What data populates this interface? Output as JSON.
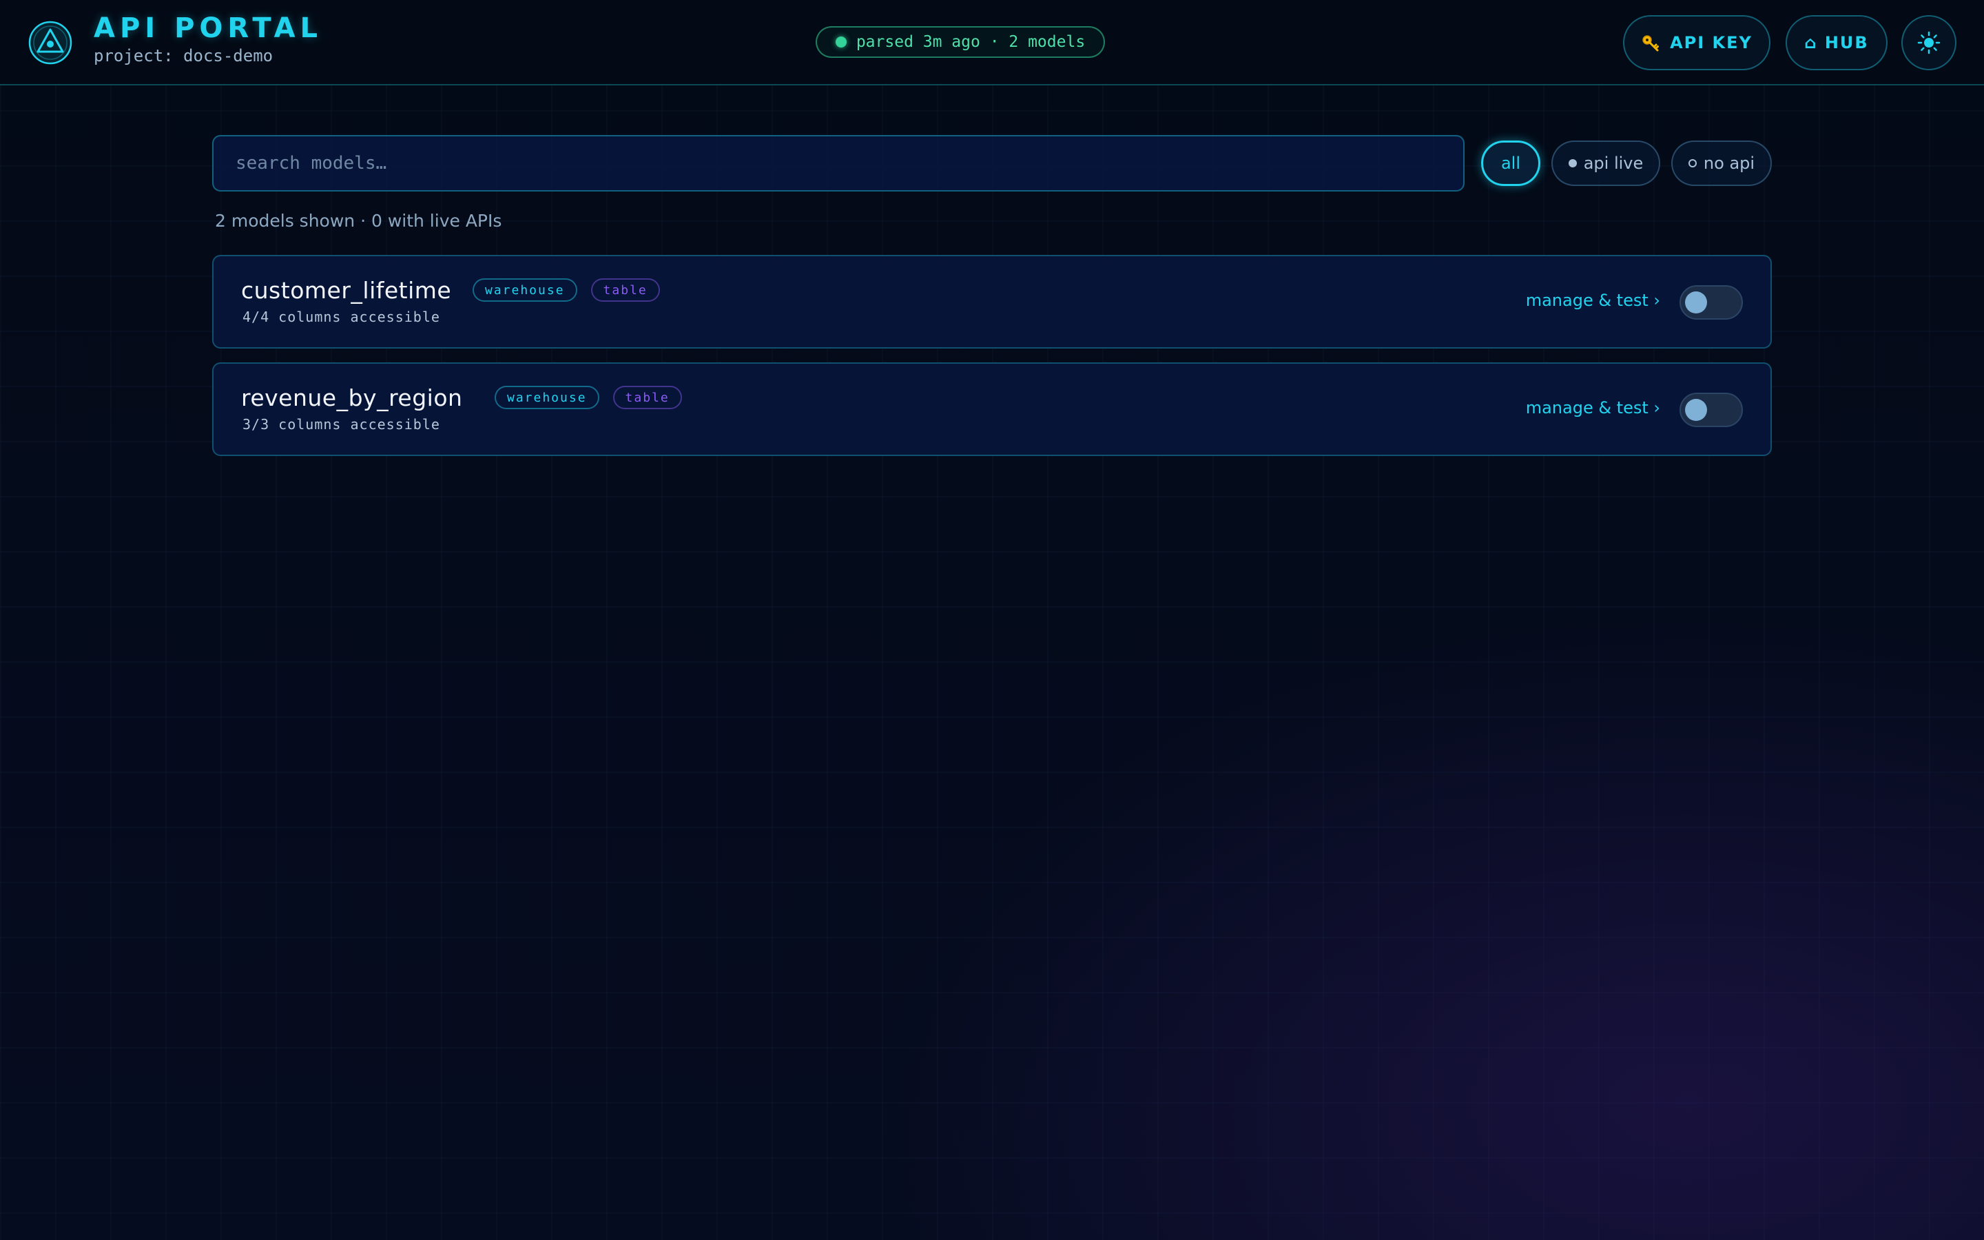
{
  "header": {
    "title": "API PORTAL",
    "project": "project: docs-demo",
    "status": "parsed 3m ago · 2 models",
    "buttons": {
      "api_key": "API KEY",
      "hub": "⌂ HUB"
    },
    "icons": {
      "logo": "logo-triangle-icon",
      "api_key": "key-icon",
      "theme": "sun-icon"
    },
    "colors": {
      "accent": "#22d3ee",
      "status": "#34d399",
      "tag_kind": "#8b5cf6"
    }
  },
  "search": {
    "placeholder": "search models…",
    "value": ""
  },
  "filters": {
    "all": "all",
    "api_live": "api live",
    "no_api": "no api",
    "selected": "all"
  },
  "summary": "2 models shown · 0 with live APIs",
  "models": [
    {
      "name": "customer_lifetime",
      "tags": [
        "warehouse",
        "table"
      ],
      "columns": "4/4 columns accessible",
      "action": "manage & test ›",
      "api_enabled": false
    },
    {
      "name": "revenue_by_region",
      "tags": [
        "warehouse",
        "table"
      ],
      "columns": "3/3 columns accessible",
      "action": "manage & test ›",
      "api_enabled": false
    }
  ]
}
